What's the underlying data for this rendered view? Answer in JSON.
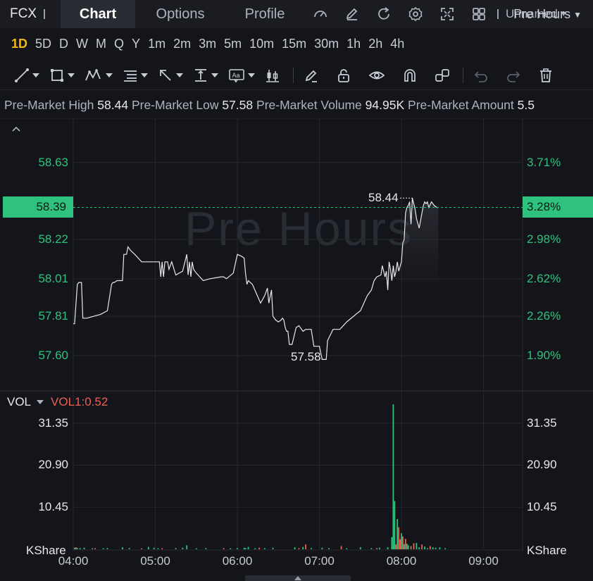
{
  "header": {
    "ticker": "FCX",
    "tabs": [
      {
        "label": "Chart",
        "active": true
      },
      {
        "label": "Options",
        "active": false
      },
      {
        "label": "Profile",
        "active": false
      }
    ],
    "icons": [
      "gauge-icon",
      "edit-icon",
      "refresh-icon",
      "settings-icon",
      "fullscreen-icon",
      "grid-layout-icon"
    ],
    "layout_name": "Unnamed"
  },
  "periods": {
    "items": [
      "1D",
      "5D",
      "D",
      "W",
      "M",
      "Q",
      "Y",
      "1m",
      "2m",
      "3m",
      "5m",
      "10m",
      "15m",
      "30m",
      "1h",
      "2h",
      "4h"
    ],
    "active": "1D",
    "session": "Pre Hours"
  },
  "drawing_tools": [
    "trend-line-icon",
    "rectangle-icon",
    "pattern-icon",
    "fib-icon",
    "arrow-icon",
    "measure-icon",
    "text-icon",
    "candle-icon",
    "pen-icon",
    "lock-icon",
    "eye-icon",
    "magnet-icon",
    "link-icon",
    "undo-icon",
    "redo-icon",
    "trash-icon"
  ],
  "info": {
    "high_label": "Pre-Market High",
    "high_value": "58.44",
    "low_label": "Pre-Market Low",
    "low_value": "57.58",
    "volume_label": "Pre-Market Volume",
    "volume_value": "94.95K",
    "amount_label": "Pre-Market Amount",
    "amount_value": "5.5"
  },
  "watermark": "Pre Hours",
  "current_price": "58.39",
  "current_pct": "3.28%",
  "high_marker": "58.44",
  "low_marker": "57.58",
  "volume_panel": {
    "name": "VOL",
    "value_label": "VOL1:0.52",
    "unit": "KShare"
  },
  "colors": {
    "up": "#2ec27e",
    "down": "#ef5f52",
    "line": "#e6e8ec",
    "accent": "#f0b90b"
  },
  "chart_data": [
    {
      "type": "line",
      "title": "",
      "y_left_ticks": [
        "58.63",
        "58.22",
        "58.01",
        "57.81",
        "57.60"
      ],
      "y_right_ticks": [
        "3.71%",
        "2.98%",
        "2.62%",
        "2.26%",
        "1.90%"
      ],
      "x_ticks": [
        "04:00",
        "05:00",
        "06:00",
        "07:00",
        "08:00",
        "09:00"
      ],
      "ylim": [
        57.42,
        58.85
      ],
      "xlim": [
        0,
        330
      ],
      "series": [
        {
          "x": [
            0,
            1,
            3,
            4,
            6,
            7,
            10,
            15,
            20,
            25,
            28,
            29,
            30,
            32,
            33,
            36,
            37,
            39,
            40,
            42,
            45,
            50,
            58,
            61,
            62,
            63,
            64,
            65,
            66,
            67,
            68,
            69,
            70,
            72,
            75,
            80,
            83,
            84,
            85,
            86,
            87,
            88,
            90,
            95,
            100,
            108,
            110,
            112,
            117,
            120,
            123,
            125,
            126,
            127,
            128,
            131,
            134,
            137,
            140,
            142,
            143,
            145,
            146,
            148,
            150,
            152,
            153,
            154,
            155,
            156,
            157,
            158,
            160,
            163,
            165,
            168,
            170,
            174,
            176,
            180,
            182,
            185,
            186,
            190,
            195,
            200,
            205,
            210,
            215,
            218,
            220,
            222,
            225,
            226,
            228,
            229,
            230,
            231,
            232,
            233,
            234,
            235,
            236,
            237,
            238,
            240,
            241,
            242,
            243,
            244,
            245,
            246,
            247,
            248,
            250,
            251,
            253,
            255,
            256,
            257,
            258,
            259,
            260,
            262,
            264,
            266,
            267
          ],
          "y": [
            57.77,
            57.77,
            57.98,
            57.99,
            57.99,
            57.8,
            57.8,
            57.81,
            57.82,
            57.84,
            57.98,
            57.99,
            57.99,
            58.0,
            58.0,
            58.0,
            58.14,
            58.14,
            58.18,
            58.16,
            58.14,
            58.1,
            58.1,
            58.1,
            58.1,
            58.1,
            58.02,
            58.1,
            58.02,
            58.1,
            58.1,
            58.1,
            58.06,
            58.1,
            58.03,
            58.05,
            58.14,
            58.03,
            58.1,
            58.02,
            58.1,
            58.06,
            58.04,
            58.0,
            58.01,
            58.02,
            58.02,
            58.01,
            58.04,
            58.14,
            58.13,
            58.12,
            58.04,
            57.98,
            58.0,
            57.98,
            57.93,
            57.88,
            57.92,
            57.96,
            57.88,
            57.95,
            57.81,
            57.79,
            57.78,
            57.79,
            57.8,
            57.79,
            57.75,
            57.73,
            57.73,
            57.66,
            57.66,
            57.75,
            57.76,
            57.73,
            57.74,
            57.74,
            57.65,
            57.65,
            57.58,
            57.58,
            57.68,
            57.74,
            57.74,
            57.78,
            57.81,
            57.84,
            57.92,
            57.95,
            58.0,
            58.02,
            58.03,
            58.08,
            58.02,
            58.05,
            57.95,
            58.1,
            58.06,
            58.0,
            58.08,
            58.02,
            58.05,
            58.1,
            58.05,
            58.1,
            58.2,
            58.22,
            58.36,
            58.39,
            58.4,
            58.42,
            58.3,
            58.44,
            58.38,
            58.33,
            58.28,
            58.36,
            58.4,
            58.42,
            58.41,
            58.42,
            58.39,
            58.42,
            58.4,
            58.39,
            58.39
          ]
        }
      ]
    },
    {
      "type": "bar",
      "title": "",
      "y_ticks": [
        "31.35",
        "20.90",
        "10.45"
      ],
      "ylim": [
        0,
        39
      ],
      "xlim": [
        0,
        330
      ],
      "x_ticks": [
        "04:00",
        "05:00",
        "06:00",
        "07:00",
        "08:00",
        "09:00"
      ],
      "series": [
        {
          "x": [
            1,
            2,
            3,
            5,
            8,
            14,
            16,
            22,
            25,
            36,
            41,
            50,
            55,
            59,
            62,
            65,
            75,
            80,
            83,
            90,
            97,
            110,
            115,
            120,
            125,
            126,
            128,
            133,
            136,
            140,
            146,
            162,
            165,
            168,
            170,
            174,
            182,
            187,
            196,
            200,
            210,
            218,
            222,
            224,
            230,
            233,
            234,
            235,
            236,
            237,
            238,
            239,
            240,
            241,
            242,
            243,
            244,
            245,
            247,
            249,
            251,
            253,
            255,
            257,
            259,
            261,
            263,
            265,
            268,
            272
          ],
          "values": [
            0.4,
            0.5,
            0.3,
            0.3,
            0.4,
            0.2,
            0.3,
            0.2,
            0.3,
            0.5,
            0.3,
            0.2,
            0.6,
            0.4,
            0.2,
            0.3,
            0.3,
            0.4,
            1.0,
            0.2,
            0.3,
            0.3,
            0.2,
            0.3,
            0.4,
            0.3,
            0.6,
            0.2,
            0.4,
            0.3,
            0.4,
            0.5,
            0.3,
            0.6,
            1.2,
            0.3,
            0.4,
            0.3,
            0.8,
            0.2,
            0.5,
            0.3,
            0.3,
            0.4,
            0.5,
            3.0,
            36.0,
            12.0,
            1.2,
            7.5,
            5.5,
            2.5,
            4.0,
            3.2,
            1.3,
            2.6,
            1.4,
            1.0,
            0.8,
            1.5,
            1.6,
            0.5,
            1.2,
            0.7,
            0.3,
            0.8,
            0.5,
            0.4,
            0.5,
            0.3
          ],
          "up": [
            true,
            false,
            true,
            true,
            true,
            true,
            false,
            true,
            true,
            true,
            true,
            false,
            true,
            true,
            true,
            false,
            true,
            true,
            true,
            true,
            true,
            false,
            true,
            true,
            true,
            true,
            true,
            true,
            false,
            true,
            true,
            true,
            false,
            true,
            false,
            true,
            true,
            true,
            false,
            true,
            true,
            true,
            false,
            true,
            true,
            true,
            true,
            true,
            false,
            true,
            false,
            false,
            true,
            false,
            true,
            false,
            true,
            true,
            false,
            false,
            true,
            true,
            false,
            true,
            true,
            false,
            true,
            true,
            true,
            true
          ]
        }
      ]
    }
  ]
}
